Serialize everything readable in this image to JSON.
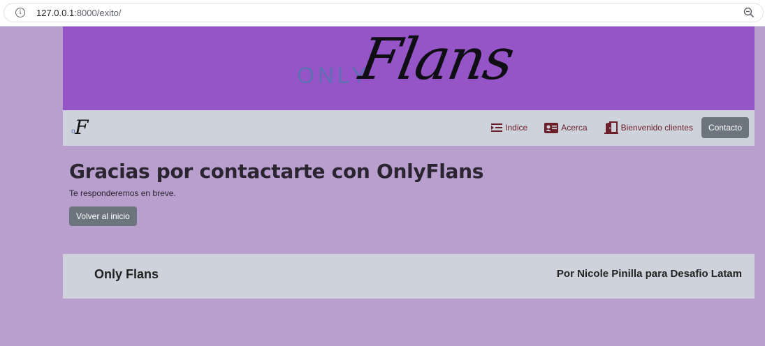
{
  "browser": {
    "url_host": "127.0.0.1",
    "url_rest": ":8000/exito/"
  },
  "banner": {
    "logo_small": "ONLY",
    "logo_large": "Flans"
  },
  "navbar": {
    "brand_o": "o",
    "brand_f": "F",
    "links": [
      {
        "label": "Indice",
        "icon": "list-indent-icon"
      },
      {
        "label": "Acerca",
        "icon": "id-card-icon"
      },
      {
        "label": "Bienvenido clientes",
        "icon": "door-open-icon"
      }
    ],
    "contact_label": "Contacto"
  },
  "main": {
    "title": "Gracias por contactarte con OnlyFlans",
    "message": "Te responderemos en breve.",
    "back_label": "Volver al inicio"
  },
  "footer": {
    "left": "Only Flans",
    "right": "Por Nicole Pinilla para Desafio Latam"
  },
  "colors": {
    "background": "#b89fcd",
    "banner": "#9555c6",
    "navbar": "#ced2da",
    "link": "#6b1f2b",
    "button": "#6c757d"
  }
}
